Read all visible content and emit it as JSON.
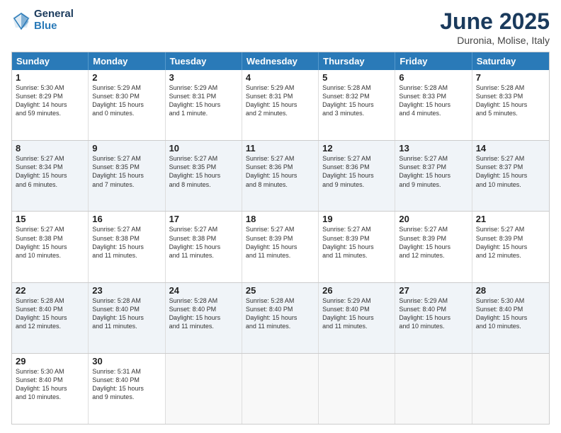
{
  "logo": {
    "line1": "General",
    "line2": "Blue"
  },
  "title": "June 2025",
  "subtitle": "Duronia, Molise, Italy",
  "header_days": [
    "Sunday",
    "Monday",
    "Tuesday",
    "Wednesday",
    "Thursday",
    "Friday",
    "Saturday"
  ],
  "rows": [
    [
      {
        "day": "1",
        "lines": [
          "Sunrise: 5:30 AM",
          "Sunset: 8:29 PM",
          "Daylight: 14 hours",
          "and 59 minutes."
        ]
      },
      {
        "day": "2",
        "lines": [
          "Sunrise: 5:29 AM",
          "Sunset: 8:30 PM",
          "Daylight: 15 hours",
          "and 0 minutes."
        ]
      },
      {
        "day": "3",
        "lines": [
          "Sunrise: 5:29 AM",
          "Sunset: 8:31 PM",
          "Daylight: 15 hours",
          "and 1 minute."
        ]
      },
      {
        "day": "4",
        "lines": [
          "Sunrise: 5:29 AM",
          "Sunset: 8:31 PM",
          "Daylight: 15 hours",
          "and 2 minutes."
        ]
      },
      {
        "day": "5",
        "lines": [
          "Sunrise: 5:28 AM",
          "Sunset: 8:32 PM",
          "Daylight: 15 hours",
          "and 3 minutes."
        ]
      },
      {
        "day": "6",
        "lines": [
          "Sunrise: 5:28 AM",
          "Sunset: 8:33 PM",
          "Daylight: 15 hours",
          "and 4 minutes."
        ]
      },
      {
        "day": "7",
        "lines": [
          "Sunrise: 5:28 AM",
          "Sunset: 8:33 PM",
          "Daylight: 15 hours",
          "and 5 minutes."
        ]
      }
    ],
    [
      {
        "day": "8",
        "lines": [
          "Sunrise: 5:27 AM",
          "Sunset: 8:34 PM",
          "Daylight: 15 hours",
          "and 6 minutes."
        ]
      },
      {
        "day": "9",
        "lines": [
          "Sunrise: 5:27 AM",
          "Sunset: 8:35 PM",
          "Daylight: 15 hours",
          "and 7 minutes."
        ]
      },
      {
        "day": "10",
        "lines": [
          "Sunrise: 5:27 AM",
          "Sunset: 8:35 PM",
          "Daylight: 15 hours",
          "and 8 minutes."
        ]
      },
      {
        "day": "11",
        "lines": [
          "Sunrise: 5:27 AM",
          "Sunset: 8:36 PM",
          "Daylight: 15 hours",
          "and 8 minutes."
        ]
      },
      {
        "day": "12",
        "lines": [
          "Sunrise: 5:27 AM",
          "Sunset: 8:36 PM",
          "Daylight: 15 hours",
          "and 9 minutes."
        ]
      },
      {
        "day": "13",
        "lines": [
          "Sunrise: 5:27 AM",
          "Sunset: 8:37 PM",
          "Daylight: 15 hours",
          "and 9 minutes."
        ]
      },
      {
        "day": "14",
        "lines": [
          "Sunrise: 5:27 AM",
          "Sunset: 8:37 PM",
          "Daylight: 15 hours",
          "and 10 minutes."
        ]
      }
    ],
    [
      {
        "day": "15",
        "lines": [
          "Sunrise: 5:27 AM",
          "Sunset: 8:38 PM",
          "Daylight: 15 hours",
          "and 10 minutes."
        ]
      },
      {
        "day": "16",
        "lines": [
          "Sunrise: 5:27 AM",
          "Sunset: 8:38 PM",
          "Daylight: 15 hours",
          "and 11 minutes."
        ]
      },
      {
        "day": "17",
        "lines": [
          "Sunrise: 5:27 AM",
          "Sunset: 8:38 PM",
          "Daylight: 15 hours",
          "and 11 minutes."
        ]
      },
      {
        "day": "18",
        "lines": [
          "Sunrise: 5:27 AM",
          "Sunset: 8:39 PM",
          "Daylight: 15 hours",
          "and 11 minutes."
        ]
      },
      {
        "day": "19",
        "lines": [
          "Sunrise: 5:27 AM",
          "Sunset: 8:39 PM",
          "Daylight: 15 hours",
          "and 11 minutes."
        ]
      },
      {
        "day": "20",
        "lines": [
          "Sunrise: 5:27 AM",
          "Sunset: 8:39 PM",
          "Daylight: 15 hours",
          "and 12 minutes."
        ]
      },
      {
        "day": "21",
        "lines": [
          "Sunrise: 5:27 AM",
          "Sunset: 8:39 PM",
          "Daylight: 15 hours",
          "and 12 minutes."
        ]
      }
    ],
    [
      {
        "day": "22",
        "lines": [
          "Sunrise: 5:28 AM",
          "Sunset: 8:40 PM",
          "Daylight: 15 hours",
          "and 12 minutes."
        ]
      },
      {
        "day": "23",
        "lines": [
          "Sunrise: 5:28 AM",
          "Sunset: 8:40 PM",
          "Daylight: 15 hours",
          "and 11 minutes."
        ]
      },
      {
        "day": "24",
        "lines": [
          "Sunrise: 5:28 AM",
          "Sunset: 8:40 PM",
          "Daylight: 15 hours",
          "and 11 minutes."
        ]
      },
      {
        "day": "25",
        "lines": [
          "Sunrise: 5:28 AM",
          "Sunset: 8:40 PM",
          "Daylight: 15 hours",
          "and 11 minutes."
        ]
      },
      {
        "day": "26",
        "lines": [
          "Sunrise: 5:29 AM",
          "Sunset: 8:40 PM",
          "Daylight: 15 hours",
          "and 11 minutes."
        ]
      },
      {
        "day": "27",
        "lines": [
          "Sunrise: 5:29 AM",
          "Sunset: 8:40 PM",
          "Daylight: 15 hours",
          "and 10 minutes."
        ]
      },
      {
        "day": "28",
        "lines": [
          "Sunrise: 5:30 AM",
          "Sunset: 8:40 PM",
          "Daylight: 15 hours",
          "and 10 minutes."
        ]
      }
    ],
    [
      {
        "day": "29",
        "lines": [
          "Sunrise: 5:30 AM",
          "Sunset: 8:40 PM",
          "Daylight: 15 hours",
          "and 10 minutes."
        ]
      },
      {
        "day": "30",
        "lines": [
          "Sunrise: 5:31 AM",
          "Sunset: 8:40 PM",
          "Daylight: 15 hours",
          "and 9 minutes."
        ]
      },
      {
        "day": "",
        "lines": []
      },
      {
        "day": "",
        "lines": []
      },
      {
        "day": "",
        "lines": []
      },
      {
        "day": "",
        "lines": []
      },
      {
        "day": "",
        "lines": []
      }
    ]
  ]
}
